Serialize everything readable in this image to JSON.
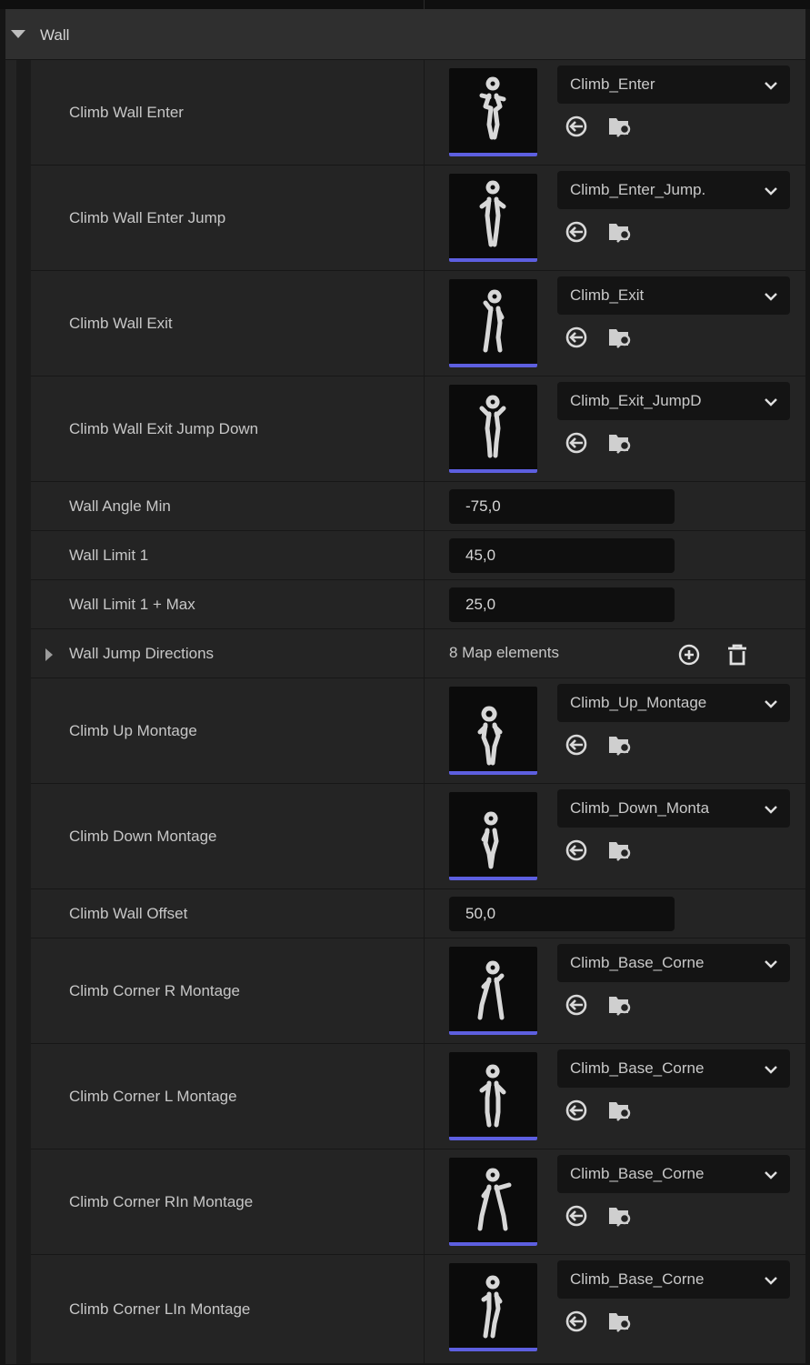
{
  "section": {
    "title": "Wall"
  },
  "rows": [
    {
      "type": "asset",
      "label": "Climb Wall Enter",
      "value": "Climb_Enter"
    },
    {
      "type": "asset",
      "label": "Climb Wall Enter Jump",
      "value": "Climb_Enter_Jump."
    },
    {
      "type": "asset",
      "label": "Climb Wall Exit",
      "value": "Climb_Exit"
    },
    {
      "type": "asset",
      "label": "Climb Wall Exit Jump Down",
      "value": "Climb_Exit_JumpD"
    },
    {
      "type": "number",
      "label": "Wall Angle Min",
      "value": "-75,0"
    },
    {
      "type": "number",
      "label": "Wall Limit 1",
      "value": "45,0"
    },
    {
      "type": "number",
      "label": "Wall Limit 1 + Max",
      "value": "25,0"
    },
    {
      "type": "map",
      "label": "Wall Jump Directions",
      "value": "8 Map elements"
    },
    {
      "type": "asset",
      "label": "Climb Up Montage",
      "value": "Climb_Up_Montage"
    },
    {
      "type": "asset",
      "label": "Climb Down Montage",
      "value": "Climb_Down_Monta"
    },
    {
      "type": "number",
      "label": "Climb Wall Offset",
      "value": "50,0"
    },
    {
      "type": "asset",
      "label": "Climb Corner R Montage",
      "value": "Climb_Base_Corne"
    },
    {
      "type": "asset",
      "label": "Climb Corner L Montage",
      "value": "Climb_Base_Corne"
    },
    {
      "type": "asset",
      "label": "Climb Corner RIn Montage",
      "value": "Climb_Base_Corne"
    },
    {
      "type": "asset",
      "label": "Climb Corner LIn Montage",
      "value": "Climb_Base_Corne"
    }
  ],
  "icons": {
    "section_toggle": "triangle-down-icon",
    "combo_arrow": "chevron-down-icon",
    "use_selected": "arrow-left-circle-icon",
    "browse": "folder-search-icon",
    "expand": "triangle-right-icon",
    "add": "plus-circle-icon",
    "remove": "trash-icon"
  },
  "colors": {
    "thumbnail_bar": "#5d5fe0",
    "panel": "#242424",
    "field": "#0f0f0f"
  }
}
